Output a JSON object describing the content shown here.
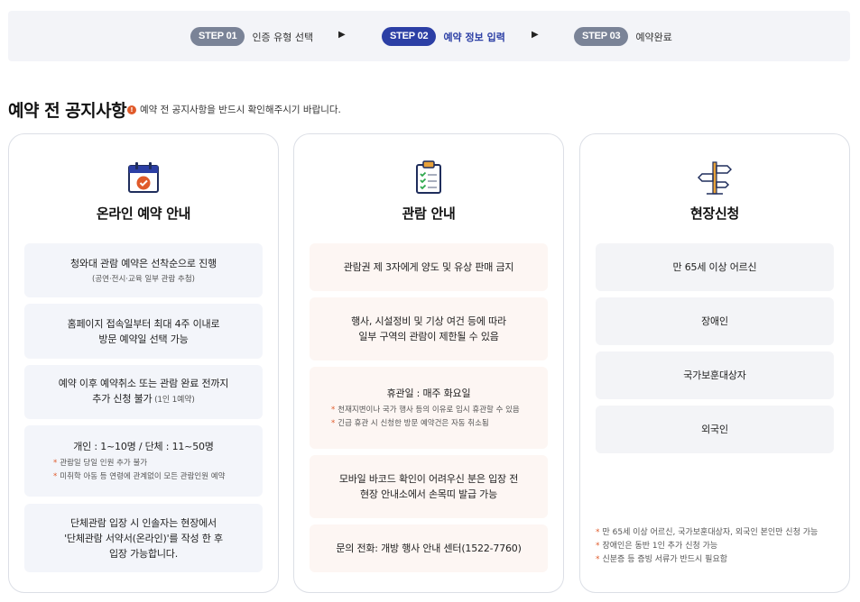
{
  "steps": [
    {
      "pill": "STEP 01",
      "label": "인증 유형 선택",
      "active": false
    },
    {
      "pill": "STEP 02",
      "label": "예약 정보 입력",
      "active": true
    },
    {
      "pill": "STEP 03",
      "label": "예약완료",
      "active": false
    }
  ],
  "step_arrow": "▶",
  "notice": {
    "title": "예약 전 공지사항",
    "info_mark": "!",
    "subtitle": "예약 전 공지사항을 반드시 확인해주시기 바랍니다."
  },
  "cards": {
    "online": {
      "title": "온라인 예약 안내",
      "icon": "calendar-check-icon",
      "items": [
        {
          "main": "청와대 관람 예약은 선착순으로 진행",
          "sub": "(공연·전시·교육 일부 관람 추첨)"
        },
        {
          "main": "홈페이지 접속일부터 최대 4주 이내로\n방문 예약일 선택 가능"
        },
        {
          "main": "예약 이후 예약취소 또는 관람 완료 전까지\n추가 신청 불가",
          "main_small": " (1인 1예약)"
        },
        {
          "main": "개인 : 1~10명 / 단체 : 11~50명",
          "bullets": [
            "관람일 당일 인원 추가 불가",
            "미취학 아동 등 연령에 관계없이 모든 관람인원 예약"
          ]
        },
        {
          "main": "단체관람 입장 시 인솔자는 현장에서\n'단체관람 서약서(온라인)'를 작성 한 후\n입장 가능합니다."
        }
      ]
    },
    "viewing": {
      "title": "관람 안내",
      "icon": "clipboard-checklist-icon",
      "items": [
        {
          "main": "관람권 제 3자에게 양도 및 유상 판매 금지"
        },
        {
          "main": "행사, 시설정비 및 기상 여건 등에 따라\n일부 구역의 관람이 제한될 수 있음"
        },
        {
          "main": "휴관일 : 매주 화요일",
          "bullets": [
            "천재지변이나 국가 행사 등의 이유로 임시 휴관할 수 있음",
            "긴급 휴관 시 신청한 방문 예약건은 자동 취소됨"
          ]
        },
        {
          "main": "모바일 바코드 확인이 어려우신 분은 입장 전\n현장 안내소에서 손목띠 발급 가능"
        },
        {
          "main": "문의 전화: 개방 행사 안내 센터(1522-7760)"
        }
      ]
    },
    "onsite": {
      "title": "현장신청",
      "icon": "signpost-icon",
      "items": [
        {
          "main": "만 65세 이상 어르신"
        },
        {
          "main": "장애인"
        },
        {
          "main": "국가보훈대상자"
        },
        {
          "main": "외국인"
        }
      ],
      "notes": [
        "만 65세 이상 어르신, 국가보훈대상자, 외국인 본인만 신청 가능",
        "장애인은 동반 1인 추가 신청 가능",
        "신분증 등 증빙 서류가 반드시 필요함"
      ]
    }
  },
  "bullet_mark": "*",
  "colors": {
    "step_active": "#2c3fa5",
    "step_inactive": "#7a8397",
    "accent_orange": "#e05a2a",
    "box_blue": "#f3f5fa",
    "box_warm": "#fdf6f3",
    "box_grey": "#f3f4f7"
  }
}
